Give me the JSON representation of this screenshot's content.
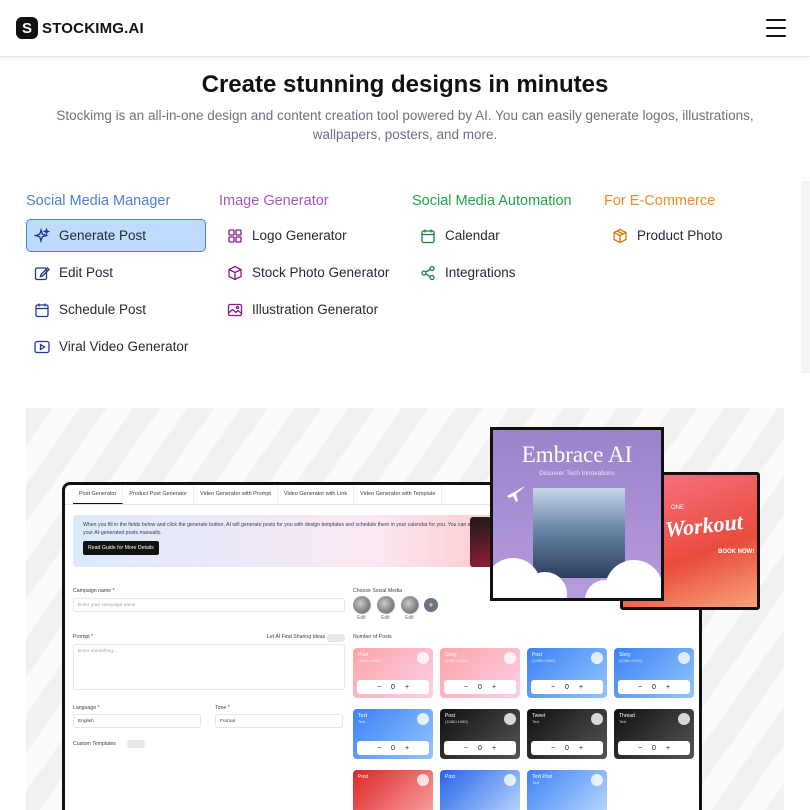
{
  "brand": {
    "logo_letter": "S",
    "name": "STOCKIMG.AI"
  },
  "nav": {
    "menu_icon": "hamburger-icon"
  },
  "hero": {
    "title": "Create stunning designs in minutes",
    "subtitle": "Stockimg is an all-in-one design and content creation tool powered by AI. You can easily generate logos, illustrations, wallpapers, posters, and more."
  },
  "columns": [
    {
      "title": "Social Media Manager",
      "color": "#4f7fd1",
      "items": [
        {
          "label": "Generate Post",
          "icon": "sparkles-icon",
          "active": true
        },
        {
          "label": "Edit Post",
          "icon": "edit-icon"
        },
        {
          "label": "Schedule Post",
          "icon": "calendar-icon"
        },
        {
          "label": "Viral Video Generator",
          "icon": "play-icon"
        }
      ]
    },
    {
      "title": "Image Generator",
      "color": "#a855c7",
      "items": [
        {
          "label": "Logo Generator",
          "icon": "grid-icon"
        },
        {
          "label": "Stock Photo Generator",
          "icon": "cube-icon"
        },
        {
          "label": "Illustration Generator",
          "icon": "image-icon"
        }
      ]
    },
    {
      "title": "Social Media Automation",
      "color": "#22a34a",
      "items": [
        {
          "label": "Calendar",
          "icon": "calendar-icon"
        },
        {
          "label": "Integrations",
          "icon": "share-icon"
        }
      ]
    },
    {
      "title": "For E-Commerce",
      "color": "#f08a24",
      "items": [
        {
          "label": "Product Photo",
          "icon": "box-icon"
        }
      ]
    }
  ],
  "preview": {
    "tabs": [
      "Post Generator",
      "Product Post Generator",
      "Video Generator with Prompt",
      "Video Generator with Link",
      "Video Generator with Template"
    ],
    "banner_text": "When you fill in the fields below and click the generate button, AI will generate posts for you with design templates and schedule them in your calendar for you. You can also edit your AI-generated posts manually.",
    "banner_button": "Read Guide for More Details",
    "campaign_label": "Campaign name *",
    "campaign_placeholder": "Enter your campaign name",
    "social_label": "Choose Social Media",
    "edit_label": "Edit",
    "prompt_label": "Prompt *",
    "prompt_placeholder": "Enter something...",
    "let_ai_label": "Let AI Find Sharing Ideas",
    "posts_label": "Number of Posts",
    "language_label": "Language *",
    "language_value": "English",
    "tone_label": "Tone *",
    "tone_value": "Formal",
    "custom_templates": "Custom Templates",
    "cards": [
      {
        "title": "Post",
        "sub": "(1080×1080)",
        "count": "0",
        "bg": "linear-gradient(135deg,#fca5a5,#fbcfe8)"
      },
      {
        "title": "Story",
        "sub": "(1080×1920)",
        "count": "0",
        "bg": "linear-gradient(135deg,#fca5a5,#fbcfe8)"
      },
      {
        "title": "Post",
        "sub": "(1080×1080)",
        "count": "0",
        "bg": "linear-gradient(135deg,#3b82f6,#93c5fd)"
      },
      {
        "title": "Story",
        "sub": "(1080×1920)",
        "count": "0",
        "bg": "linear-gradient(135deg,#3b82f6,#93c5fd)"
      },
      {
        "title": "Text",
        "sub": "Text",
        "count": "0",
        "bg": "linear-gradient(135deg,#3b82f6,#93c5fd)"
      },
      {
        "title": "Post",
        "sub": "(1080×1080)",
        "count": "0",
        "bg": "linear-gradient(135deg,#111,#555)"
      },
      {
        "title": "Tweet",
        "sub": "Text",
        "count": "0",
        "bg": "linear-gradient(135deg,#111,#555)"
      },
      {
        "title": "Thread",
        "sub": "Text",
        "count": "0",
        "bg": "linear-gradient(135deg,#111,#555)"
      },
      {
        "title": "Post",
        "sub": "",
        "count": "",
        "bg": "linear-gradient(135deg,#dc2626,#fca5a5)"
      },
      {
        "title": "Post",
        "sub": "",
        "count": "",
        "bg": "linear-gradient(135deg,#2563eb,#bfdbfe)"
      },
      {
        "title": "Text Post",
        "sub": "Text",
        "count": "",
        "bg": "linear-gradient(135deg,#3b82f6,#bfdbfe)"
      }
    ],
    "poster1_title": "Embrace AI",
    "poster1_sub": "Discover Tech Innovations",
    "poster2_title": "Workout",
    "poster2_pre": "ONE",
    "poster2_cta": "BOOK NOW!"
  }
}
